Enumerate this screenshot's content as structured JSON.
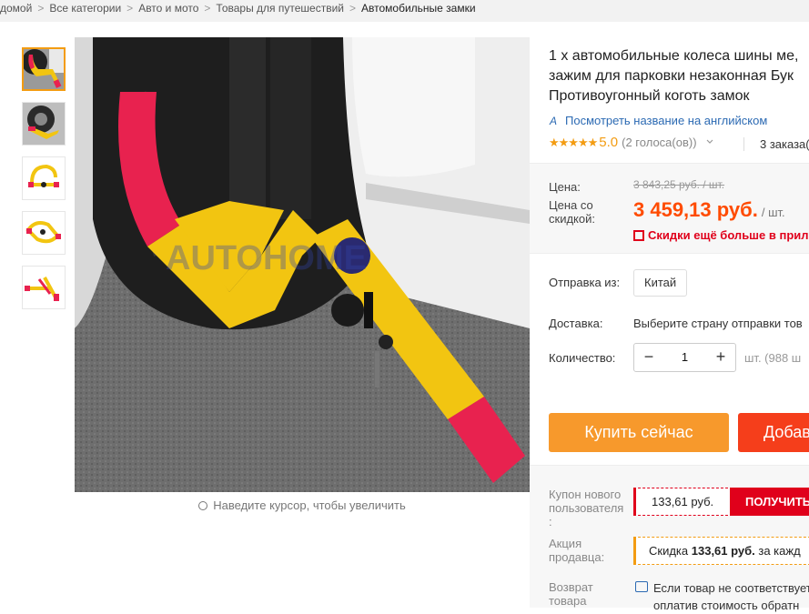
{
  "breadcrumbs": [
    "домой",
    "Все категории",
    "Авто и мото",
    "Товары для путешествий",
    "Автомобильные замки"
  ],
  "breadcrumb_separator": ">",
  "gallery": {
    "thumbnail_count": 5,
    "active_index": 0,
    "image_watermark": "AUTOHOME",
    "zoom_hint": "Наведите курсор, чтобы увеличить"
  },
  "product": {
    "title_lines": [
      "1 х автомобильные колеса шины ме,",
      "зажим для парковки незаконная Бук",
      "Противоугонный коготь замок"
    ],
    "ai_badge": "A",
    "translate_link": "Посмотреть название на английском",
    "stars": "★★★★★",
    "rating": "5.0",
    "votes": "(2 голоса(ов))",
    "orders": "3 заказа("
  },
  "price": {
    "label_price": "Цена:",
    "old_price": "3 843,25 руб. / шт.",
    "label_discount_line1": "Цена со",
    "label_discount_line2": "скидкой:",
    "new_price": "3 459,13 руб.",
    "per_unit": "/ шт.",
    "discount_more": "Скидки ещё больше в прил"
  },
  "shipping": {
    "from_label": "Отправка из:",
    "from_value": "Китай",
    "delivery_label": "Доставка:",
    "delivery_value": "Выберите страну отправки тов",
    "qty_label": "Количество:",
    "qty_minus": "−",
    "qty_value": "1",
    "qty_plus": "+",
    "qty_note": "шт. (988 ш"
  },
  "actions": {
    "buy_now": "Купить сейчас",
    "add_to_cart": "Добав"
  },
  "coupons": {
    "new_user_label_1": "Купон нового",
    "new_user_label_2": "пользователя",
    "new_user_label_3": ":",
    "coupon_amount": "133,61 руб.",
    "coupon_get": "ПОЛУЧИТЬ",
    "seller_promo_label_1": "Акция",
    "seller_promo_label_2": "продавца:",
    "seller_promo_prefix": "Скидка ",
    "seller_promo_amount": "133,61 руб.",
    "seller_promo_suffix": " за кажд",
    "return_label_1": "Возврат",
    "return_label_2": "товара",
    "return_line_1": "Если товар не соответствует",
    "return_line_2": "оплатив стоимость обратн"
  },
  "colors": {
    "accent_orange": "#f7992c",
    "cart_red": "#f53e1b",
    "price_red": "#ff4b00",
    "link_blue": "#2c6ab3",
    "star": "#f39c12"
  }
}
